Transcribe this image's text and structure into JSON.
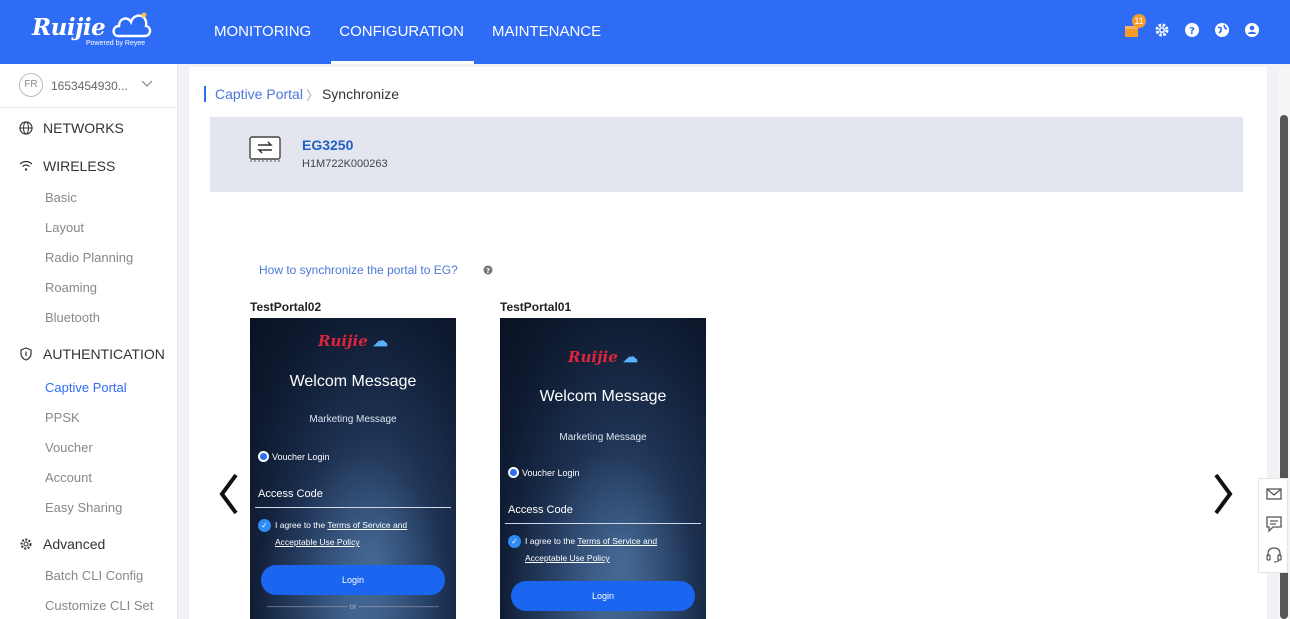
{
  "brand": {
    "logo_text": "Ruijie",
    "powered_by": "Powered by Reyee"
  },
  "topnav": {
    "items": [
      {
        "label": "MONITORING"
      },
      {
        "label": "CONFIGURATION"
      },
      {
        "label": "MAINTENANCE"
      }
    ],
    "active": "CONFIGURATION",
    "notification_count": "11",
    "icons": [
      "notification-icon",
      "settings-icon",
      "help-icon",
      "language-icon",
      "user-icon"
    ]
  },
  "sidebar": {
    "account": {
      "initials": "FR",
      "name": "1653454930..."
    },
    "networks": "NETWORKS",
    "wireless": {
      "label": "WIRELESS",
      "items": [
        "Basic",
        "Layout",
        "Radio Planning",
        "Roaming",
        "Bluetooth"
      ]
    },
    "authentication": {
      "label": "AUTHENTICATION",
      "items": [
        "Captive Portal",
        "PPSK",
        "Voucher",
        "Account",
        "Easy Sharing"
      ],
      "active": "Captive Portal"
    },
    "advanced": {
      "label": "Advanced",
      "items": [
        "Batch CLI Config",
        "Customize CLI Set"
      ]
    }
  },
  "breadcrumb": {
    "parent": "Captive Portal",
    "current": "Synchronize"
  },
  "device": {
    "model": "EG3250",
    "serial": "H1M722K000263"
  },
  "help_link": "How to synchronize the portal to EG?",
  "portals": [
    {
      "name": "TestPortal02",
      "welcome": "Welcom Message",
      "marketing": "Marketing Message",
      "voucher_login": "Voucher Login",
      "access_code": "Access Code",
      "agree_prefix": "I agree to the",
      "terms": "Terms of Service and",
      "policy": "Acceptable Use Policy",
      "login": "Login",
      "or": "or"
    },
    {
      "name": "TestPortal01",
      "welcome": "Welcom Message",
      "marketing": "Marketing Message",
      "voucher_login": "Voucher Login",
      "access_code": "Access Code",
      "agree_prefix": "I agree to the",
      "terms": "Terms of Service and",
      "policy": "Acceptable Use Policy",
      "login": "Login"
    }
  ],
  "colors": {
    "primary": "#2f6cf6",
    "link": "#4a78d8",
    "device_panel": "#e3e6ef",
    "portal_logo": "#e0243a"
  }
}
